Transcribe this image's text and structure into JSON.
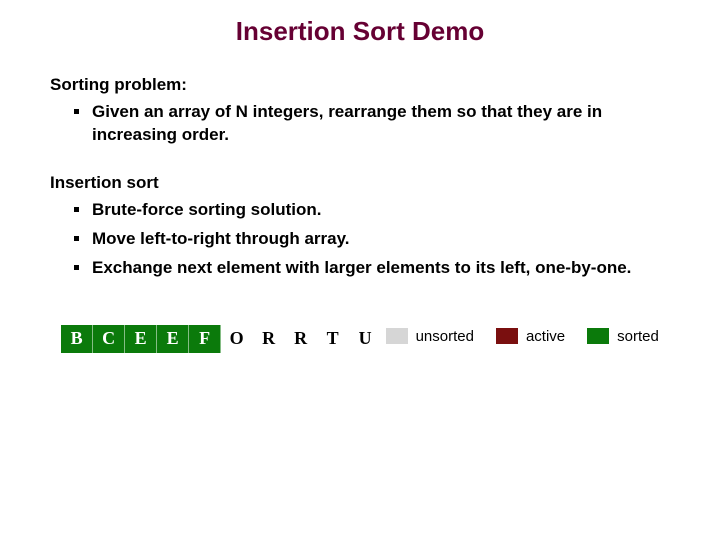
{
  "title": "Insertion Sort Demo",
  "section1": {
    "label": "Sorting problem:",
    "bullets": [
      "Given an array of N integers, rearrange them so that they are in increasing order."
    ]
  },
  "section2": {
    "label": "Insertion sort",
    "bullets": [
      "Brute-force sorting solution.",
      "Move left-to-right through array.",
      "Exchange next element with larger elements to its left, one-by-one."
    ]
  },
  "cells": [
    {
      "letter": "B",
      "state": "sorted"
    },
    {
      "letter": "C",
      "state": "sorted"
    },
    {
      "letter": "E",
      "state": "sorted"
    },
    {
      "letter": "E",
      "state": "sorted"
    },
    {
      "letter": "F",
      "state": "sorted"
    },
    {
      "letter": "O",
      "state": "final"
    },
    {
      "letter": "R",
      "state": "final"
    },
    {
      "letter": "R",
      "state": "final"
    },
    {
      "letter": "T",
      "state": "final"
    },
    {
      "letter": "U",
      "state": "final"
    }
  ],
  "legend": {
    "unsorted": "unsorted",
    "active": "active",
    "sorted": "sorted"
  }
}
